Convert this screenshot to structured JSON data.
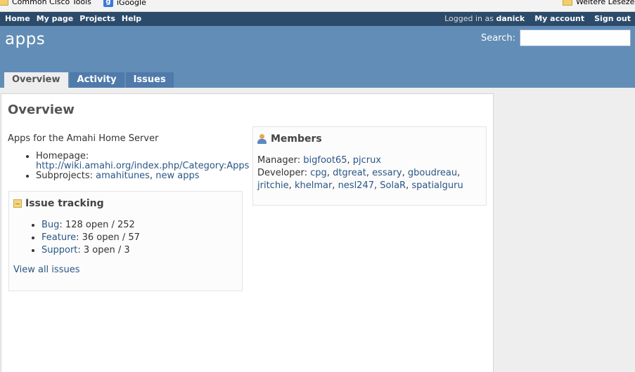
{
  "bookmarks": {
    "left": [
      {
        "icon": "folder-icon",
        "label": "Common Cisco Tools"
      },
      {
        "icon": "google-icon",
        "label": "iGoogle"
      }
    ],
    "right": {
      "icon": "folder-icon",
      "label": "Weitere Lesezeichen"
    }
  },
  "top_menu": {
    "items": [
      "Home",
      "My page",
      "Projects",
      "Help"
    ],
    "logged_in_prefix": "Logged in as",
    "username": "danick",
    "my_account": "My account",
    "sign_out": "Sign out"
  },
  "header": {
    "project_title": "apps",
    "search_label": "Search:",
    "search_value": ""
  },
  "tabs": [
    {
      "label": "Overview",
      "selected": true
    },
    {
      "label": "Activity",
      "selected": false
    },
    {
      "label": "Issues",
      "selected": false
    }
  ],
  "content": {
    "page_title": "Overview",
    "description": "Apps for the Amahi Home Server",
    "homepage_label": "Homepage:",
    "homepage_url": "http://wiki.amahi.org/index.php/Category:Apps",
    "subprojects_label": "Subprojects:",
    "subprojects": [
      "amahitunes",
      "new apps"
    ],
    "issue_tracking": {
      "title": "Issue tracking",
      "trackers": [
        {
          "name": "Bug",
          "stats": ": 128 open / 252"
        },
        {
          "name": "Feature",
          "stats": ": 36 open / 57"
        },
        {
          "name": "Support",
          "stats": ": 3 open / 3"
        }
      ],
      "view_all": "View all issues"
    },
    "members": {
      "title": "Members",
      "manager_label": "Manager:",
      "managers": [
        "bigfoot65",
        "pjcrux"
      ],
      "developer_label": "Developer:",
      "developers": [
        "cpg",
        "dtgreat",
        "essary",
        "gboudreau",
        "jritchie",
        "khelmar",
        "nesl247",
        "SolaR",
        "spatialguru"
      ]
    }
  }
}
